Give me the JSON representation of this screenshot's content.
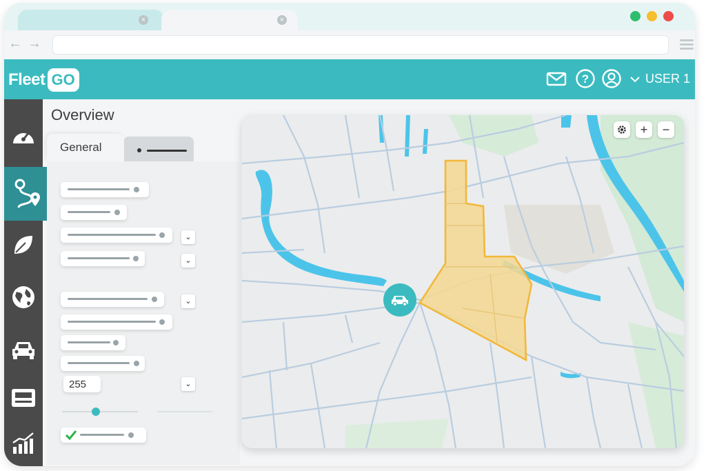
{
  "browser": {
    "tab1_close": "×",
    "tab2_close": "×",
    "window_controls": {
      "green": "#2dbd6e",
      "yellow": "#f7be2d",
      "red": "#ee4b4b"
    },
    "back_icon": "arrow-left-icon",
    "forward_icon": "arrow-right-icon"
  },
  "header": {
    "logo_fleet": "Fleet",
    "logo_go": "GO",
    "user_label": "USER 1",
    "icons": [
      "mail-icon",
      "help-icon",
      "user-icon",
      "chevron-down-icon"
    ],
    "accent": "#3bbbc0"
  },
  "sidebar": {
    "items": [
      {
        "icon": "speedometer-icon"
      },
      {
        "icon": "route-icon",
        "active": true
      },
      {
        "icon": "leaf-icon"
      },
      {
        "icon": "globe-icon"
      },
      {
        "icon": "car-icon"
      },
      {
        "icon": "terminal-icon"
      },
      {
        "icon": "chart-icon"
      }
    ]
  },
  "main": {
    "title": "Overview",
    "tabs": [
      {
        "label": "General"
      }
    ],
    "number_value": "255",
    "dropdown_glyph": "⌄"
  },
  "map": {
    "controls": [
      "settings-icon",
      "zoom-in-icon",
      "zoom-out-icon"
    ],
    "zoom_in": "+",
    "zoom_out": "−",
    "zone_color": "#f5d890",
    "water_color": "#4cc4ea"
  }
}
